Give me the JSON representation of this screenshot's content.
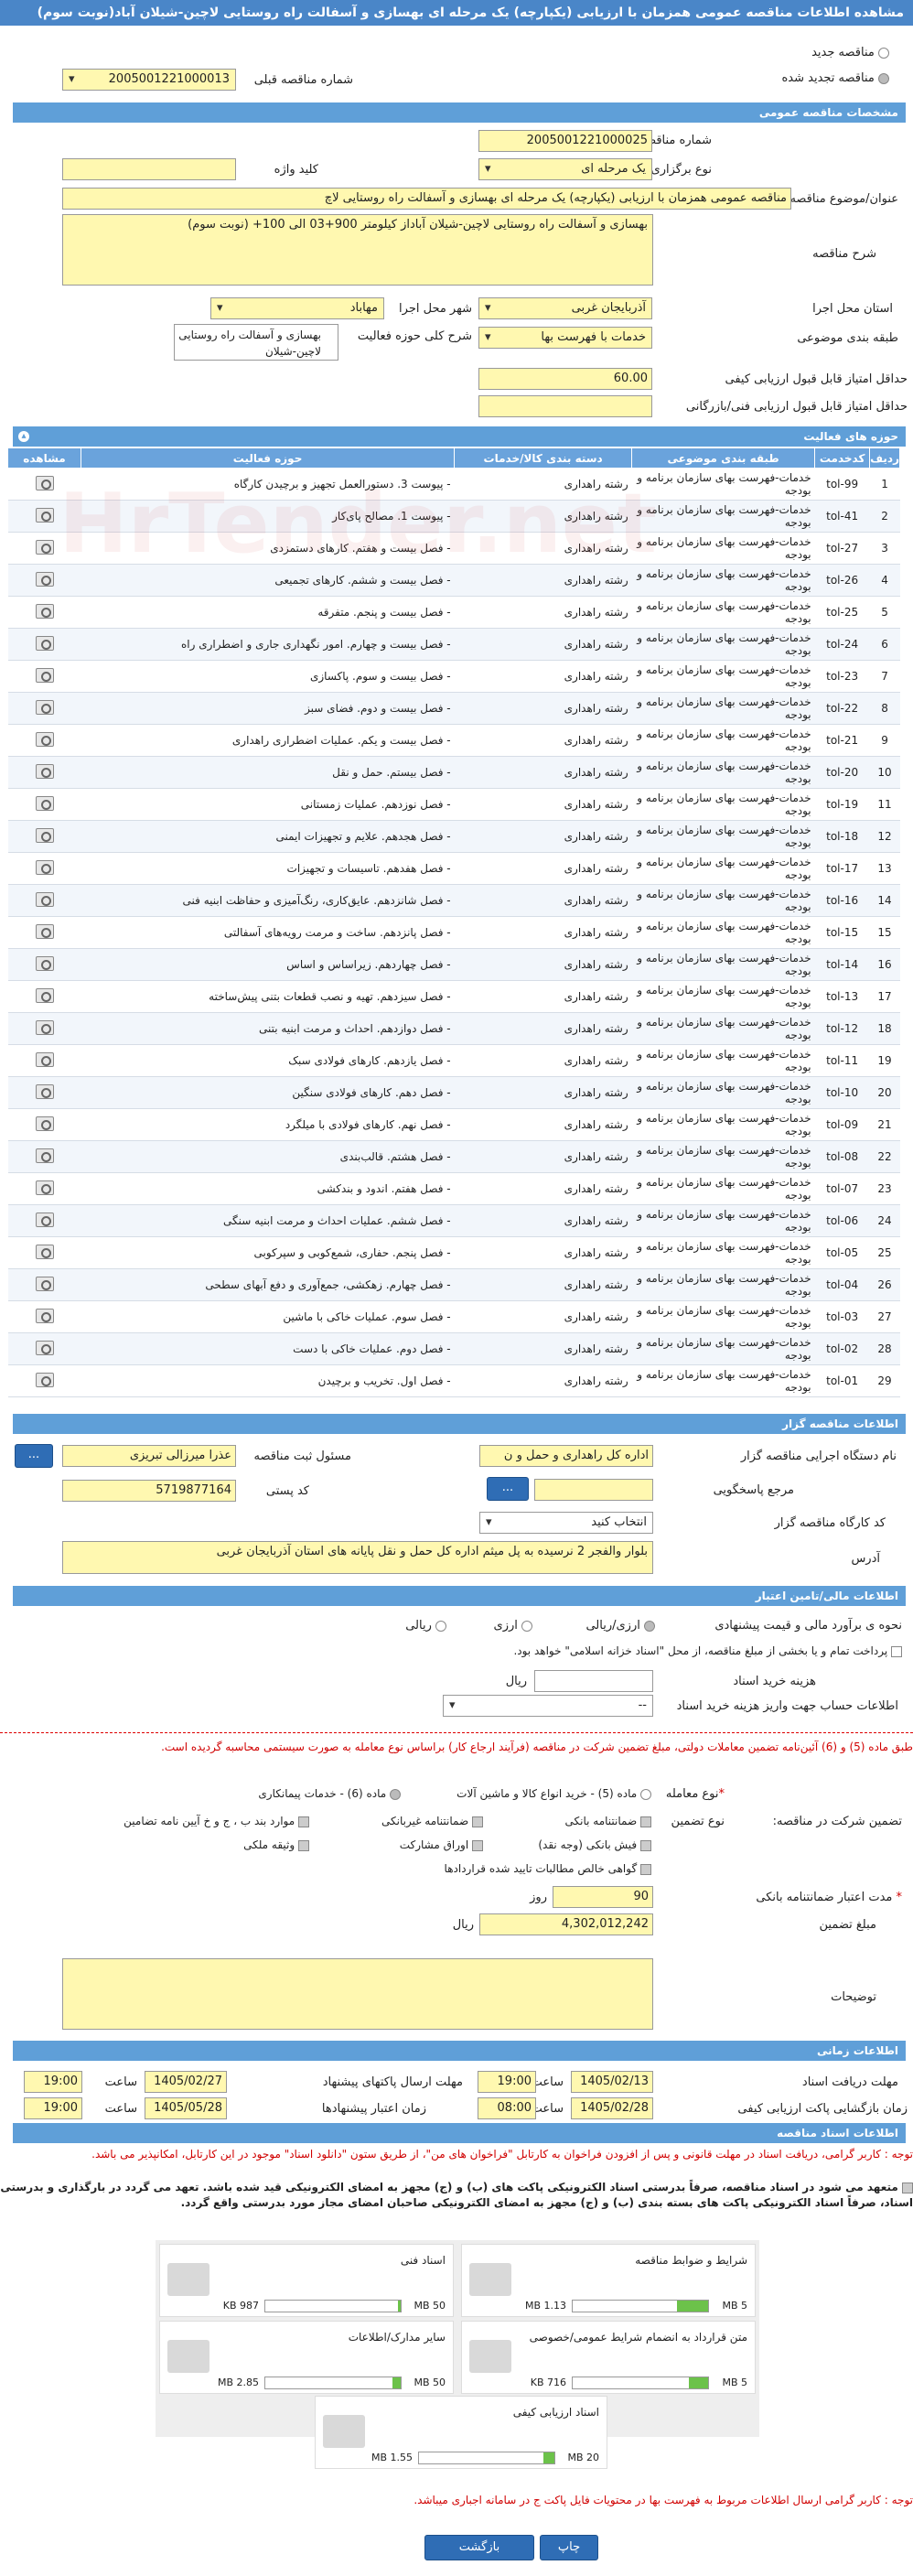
{
  "title": "مشاهده اطلاعات مناقصه عمومی همزمان با ارزیابی (یکپارچه) یک مرحله ای بهسازی و آسفالت راه روستایی لاچین-شیلان آباد(نوبت سوم)",
  "radio_new": "مناقصه جدید",
  "radio_renew": "مناقصه تجدید شده",
  "prev_number_label": "شماره مناقصه قبلی",
  "prev_number": "2005001221000013",
  "sections": {
    "general": "مشخصات مناقصه عمومی",
    "items": "حوزه های فعالیت",
    "organizer": "اطلاعات مناقصه گزار",
    "financial": "اطلاعات مالی/تامین اعتبار",
    "timing": "اطلاعات زمانی",
    "docs": "اطلاعات اسناد مناقصه"
  },
  "general": {
    "number_label": "شماره مناقصه",
    "number": "2005001221000025",
    "type_label": "نوع برگزاری",
    "type": "یک مرحله ای",
    "keyword_label": "کلید واژه",
    "keyword": "",
    "subject_label": "عنوان/موضوع مناقصه",
    "subject": "مناقصه عمومی همزمان با ارزیابی (یکپارچه) یک مرحله ای بهسازی و آسفالت راه روستایی لاچ",
    "desc_label": "شرح مناقصه",
    "desc": "بهسازی و آسفالت راه روستایی لاچین-شیلان آباداز کیلومتر 900+03 الی 100+ (نوبت سوم)",
    "province_label": "استان محل اجرا",
    "province": "آذربایجان غربی",
    "city_label": "شهر محل اجرا",
    "city": "مهاباد",
    "category_label": "طبقه بندی موضوعی",
    "category": "خدمات با فهرست بها",
    "scope_label": "شرح کلی حوزه فعالیت",
    "scope": "بهسازی و آسفالت راه روستایی لاچین-شیلان",
    "min_quality_label": "حداقل امتیاز قابل قبول ارزیابی کیفی",
    "min_quality": "60.00",
    "min_tech_label": "حداقل امتیاز قابل قبول ارزیابی فنی/بازرگانی",
    "min_tech": ""
  },
  "items_headers": [
    "ردیف",
    "کدخدمت",
    "طبقه بندی موضوعی",
    "دسته بندی کالا/خدمات",
    "حوزه فعالیت",
    "مشاهده"
  ],
  "items": [
    [
      "1",
      "tol-99",
      "خدمات-فهرست بهای سازمان برنامه و بودجه",
      "رشته راهداری",
      "- پیوست 3. دستورالعمل تجهیز و برچیدن کارگاه"
    ],
    [
      "2",
      "tol-41",
      "خدمات-فهرست بهای سازمان برنامه و بودجه",
      "رشته راهداری",
      "- پیوست 1. مصالح پای‌کار"
    ],
    [
      "3",
      "tol-27",
      "خدمات-فهرست بهای سازمان برنامه و بودجه",
      "رشته راهداری",
      "- فصل بیست و هفتم. کارهای دستمزدی"
    ],
    [
      "4",
      "tol-26",
      "خدمات-فهرست بهای سازمان برنامه و بودجه",
      "رشته راهداری",
      "- فصل بیست و ششم. کارهای تجمیعی"
    ],
    [
      "5",
      "tol-25",
      "خدمات-فهرست بهای سازمان برنامه و بودجه",
      "رشته راهداری",
      "- فصل بیست و پنجم. متفرقه"
    ],
    [
      "6",
      "tol-24",
      "خدمات-فهرست بهای سازمان برنامه و بودجه",
      "رشته راهداری",
      "- فصل بیست و چهارم. امور نگهداری جاری و اضطراری راه"
    ],
    [
      "7",
      "tol-23",
      "خدمات-فهرست بهای سازمان برنامه و بودجه",
      "رشته راهداری",
      "- فصل بیست و سوم. پاکسازی"
    ],
    [
      "8",
      "tol-22",
      "خدمات-فهرست بهای سازمان برنامه و بودجه",
      "رشته راهداری",
      "- فصل بیست و دوم. فضای سبز"
    ],
    [
      "9",
      "tol-21",
      "خدمات-فهرست بهای سازمان برنامه و بودجه",
      "رشته راهداری",
      "- فصل بیست و یکم. عملیات اضطراری راهداری"
    ],
    [
      "10",
      "tol-20",
      "خدمات-فهرست بهای سازمان برنامه و بودجه",
      "رشته راهداری",
      "- فصل بیستم. حمل و نقل"
    ],
    [
      "11",
      "tol-19",
      "خدمات-فهرست بهای سازمان برنامه و بودجه",
      "رشته راهداری",
      "- فصل نوزدهم. عملیات زمستانی"
    ],
    [
      "12",
      "tol-18",
      "خدمات-فهرست بهای سازمان برنامه و بودجه",
      "رشته راهداری",
      "- فصل هجدهم. علایم و تجهیزات ایمنی"
    ],
    [
      "13",
      "tol-17",
      "خدمات-فهرست بهای سازمان برنامه و بودجه",
      "رشته راهداری",
      "- فصل هفدهم. تاسیسات و تجهیزات"
    ],
    [
      "14",
      "tol-16",
      "خدمات-فهرست بهای سازمان برنامه و بودجه",
      "رشته راهداری",
      "- فصل شانزدهم. عایق‌کاری، رنگ‌آمیزی و حفاظت ابنیه فنی"
    ],
    [
      "15",
      "tol-15",
      "خدمات-فهرست بهای سازمان برنامه و بودجه",
      "رشته راهداری",
      "- فصل پانزدهم. ساخت و مرمت رویه‌های آسفالتی"
    ],
    [
      "16",
      "tol-14",
      "خدمات-فهرست بهای سازمان برنامه و بودجه",
      "رشته راهداری",
      "- فصل چهاردهم. زیراساس و اساس"
    ],
    [
      "17",
      "tol-13",
      "خدمات-فهرست بهای سازمان برنامه و بودجه",
      "رشته راهداری",
      "- فصل سیزدهم. تهیه و نصب قطعات بتنی پیش‌ساخته"
    ],
    [
      "18",
      "tol-12",
      "خدمات-فهرست بهای سازمان برنامه و بودجه",
      "رشته راهداری",
      "- فصل دوازدهم. احداث و مرمت ابنیه بتنی"
    ],
    [
      "19",
      "tol-11",
      "خدمات-فهرست بهای سازمان برنامه و بودجه",
      "رشته راهداری",
      "- فصل یازدهم. کارهای فولادی سبک"
    ],
    [
      "20",
      "tol-10",
      "خدمات-فهرست بهای سازمان برنامه و بودجه",
      "رشته راهداری",
      "- فصل دهم. کارهای فولادی سنگین"
    ],
    [
      "21",
      "tol-09",
      "خدمات-فهرست بهای سازمان برنامه و بودجه",
      "رشته راهداری",
      "- فصل نهم. کارهای فولادی با میلگرد"
    ],
    [
      "22",
      "tol-08",
      "خدمات-فهرست بهای سازمان برنامه و بودجه",
      "رشته راهداری",
      "- فصل هشتم. قالب‌بندی"
    ],
    [
      "23",
      "tol-07",
      "خدمات-فهرست بهای سازمان برنامه و بودجه",
      "رشته راهداری",
      "- فصل هفتم. اندود و بندکشی"
    ],
    [
      "24",
      "tol-06",
      "خدمات-فهرست بهای سازمان برنامه و بودجه",
      "رشته راهداری",
      "- فصل ششم. عملیات احداث و مرمت ابنیه سنگی"
    ],
    [
      "25",
      "tol-05",
      "خدمات-فهرست بهای سازمان برنامه و بودجه",
      "رشته راهداری",
      "- فصل پنجم. حفاری، شمع‌کوبی و سپرکوبی"
    ],
    [
      "26",
      "tol-04",
      "خدمات-فهرست بهای سازمان برنامه و بودجه",
      "رشته راهداری",
      "- فصل چهارم. زهکشی، جمع‌آوری و دفع آبهای سطحی"
    ],
    [
      "27",
      "tol-03",
      "خدمات-فهرست بهای سازمان برنامه و بودجه",
      "رشته راهداری",
      "- فصل سوم. عملیات خاکی با ماشین"
    ],
    [
      "28",
      "tol-02",
      "خدمات-فهرست بهای سازمان برنامه و بودجه",
      "رشته راهداری",
      "- فصل دوم. عملیات خاکی با دست"
    ],
    [
      "29",
      "tol-01",
      "خدمات-فهرست بهای سازمان برنامه و بودجه",
      "رشته راهداری",
      "- فصل اول. تخریب و برچیدن"
    ]
  ],
  "organizer": {
    "org_label": "نام دستگاه اجرایی مناقصه گزار",
    "org": "اداره کل راهداری و حمل و ن",
    "resp_label": "مسئول ثبت مناقصه",
    "resp": "عذرا میرزالی تبریزی",
    "ref_label": "مرجع پاسخگویی",
    "ref": "",
    "postal_label": "کد پستی",
    "postal": "5719877164",
    "workshop_label": "کد کارگاه مناقصه گزار",
    "workshop": "انتخاب کنید",
    "addr_label": "آدرس",
    "addr": "بلوار والفجر 2 نرسیده به پل میثم اداره کل حمل و نقل پایانه های استان آذربایجان غربی"
  },
  "financial": {
    "method_label": "نحوه ی برآورد مالی و قیمت پیشنهادی",
    "opt_currency": "ارزی/ریالی",
    "opt_fx": "ارزی",
    "opt_rial": "ریالی",
    "note": "پرداخت تمام و یا بخشی از مبلغ مناقصه، از محل \"اسناد خزانه اسلامی\" خواهد بود.",
    "fee_label": "هزینه خرید اسناد",
    "fee_unit": "ریال",
    "account_label": "اطلاعات حساب جهت واریز هزینه خرید اسناد",
    "account": "--",
    "warning": "طبق ماده (5) و (6) آئین‌نامه تضمین معاملات دولتی، مبلغ تضمین شرکت در مناقصه (فرآیند ارجاع کار) براساس نوع معامله به صورت سیستمی محاسبه گردیده است.",
    "trade_type_label": "نوع معامله",
    "trade_opts": [
      "ماده (5) - خرید انواع کالا و ماشین آلات",
      "ماده (6) - خدمات پیمانکاری"
    ],
    "guar_label": "تضمین شرکت در مناقصه:",
    "guar_type_label": "نوع تضمین",
    "guar_opts": [
      "ضمانتنامه بانکی",
      "ضمانتنامه غیربانکی",
      "موارد بند ب ، ج و خ آیین نامه تضامین",
      "فیش بانکی (وجه نقد)",
      "اوراق مشارکت",
      "وثیقه ملکی",
      "گواهی خالص مطالبات تایید شده قراردادها"
    ],
    "validity_label": "مدت اعتبار ضمانتنامه بانکی",
    "validity": "90",
    "validity_unit": "روز",
    "amount_label": "مبلغ تضمین",
    "amount": "4,302,012,242",
    "amount_unit": "ریال",
    "notes_label": "توضیحات"
  },
  "timing": {
    "doc_recv_label": "مهلت دریافت اسناد",
    "doc_recv_date": "1405/02/13",
    "doc_recv_time": "19:00",
    "send_label": "مهلت ارسال پاکتهای پیشنهاد",
    "send_date": "1405/02/27",
    "send_time": "19:00",
    "open_label": "زمان بازگشایی پاکت ارزیابی کیفی",
    "open_date": "1405/02/28",
    "open_time": "08:00",
    "valid_label": "زمان اعتبار پیشنهادها",
    "valid_date": "1405/05/28",
    "valid_time": "19:00",
    "time_word": "ساعت"
  },
  "docs": {
    "notice1": "توجه : کاربر گرامی، دریافت اسناد در مهلت قانونی و پس از افزودن فراخوان به کارتابل \"فراخوان های من\"، از طریق ستون \"دانلود اسناد\" موجود در این کارتابل، امکانپذیر می باشد.",
    "notice2": "متعهد می شود در اسناد مناقصه، صرفاً بدرستی اسناد الکترونیکی پاکت های (ب) و (ج) مجهز به امضای الکترونیکی قید شده باشد. تعهد می گردد در بارگذاری و بدرستی اسناد، صرفاً اسناد الکترونیکی پاکت های بسته بندی (ب) و (ج) مجهز به امضای الکترونیکی صاحبان امضای مجاز مورد بدرستی واقع گردد.",
    "files": [
      {
        "name": "شرایط و ضوابط مناقصه",
        "size": "1.13 MB",
        "max": "5 MB",
        "fill": 0.23
      },
      {
        "name": "اسناد فنی",
        "size": "987 KB",
        "max": "50 MB",
        "fill": 0.02
      },
      {
        "name": "متن قرارداد به انضمام شرایط عمومی/خصوصی",
        "size": "716 KB",
        "max": "5 MB",
        "fill": 0.14
      },
      {
        "name": "سایر مدارک/اطلاعات",
        "size": "2.85 MB",
        "max": "50 MB",
        "fill": 0.06
      },
      {
        "name": "اسناد ارزیابی کیفی",
        "size": "1.55 MB",
        "max": "20 MB",
        "fill": 0.08
      }
    ],
    "notice3": "توجه : کاربر گرامی ارسال اطلاعات مربوط به فهرست بها در محتویات فایل پاکت ج در سامانه اجباری میباشد."
  },
  "buttons": {
    "print": "چاپ",
    "back": "بازگشت",
    "dots": "...",
    "search": "..."
  },
  "watermark": "HrTender.net"
}
